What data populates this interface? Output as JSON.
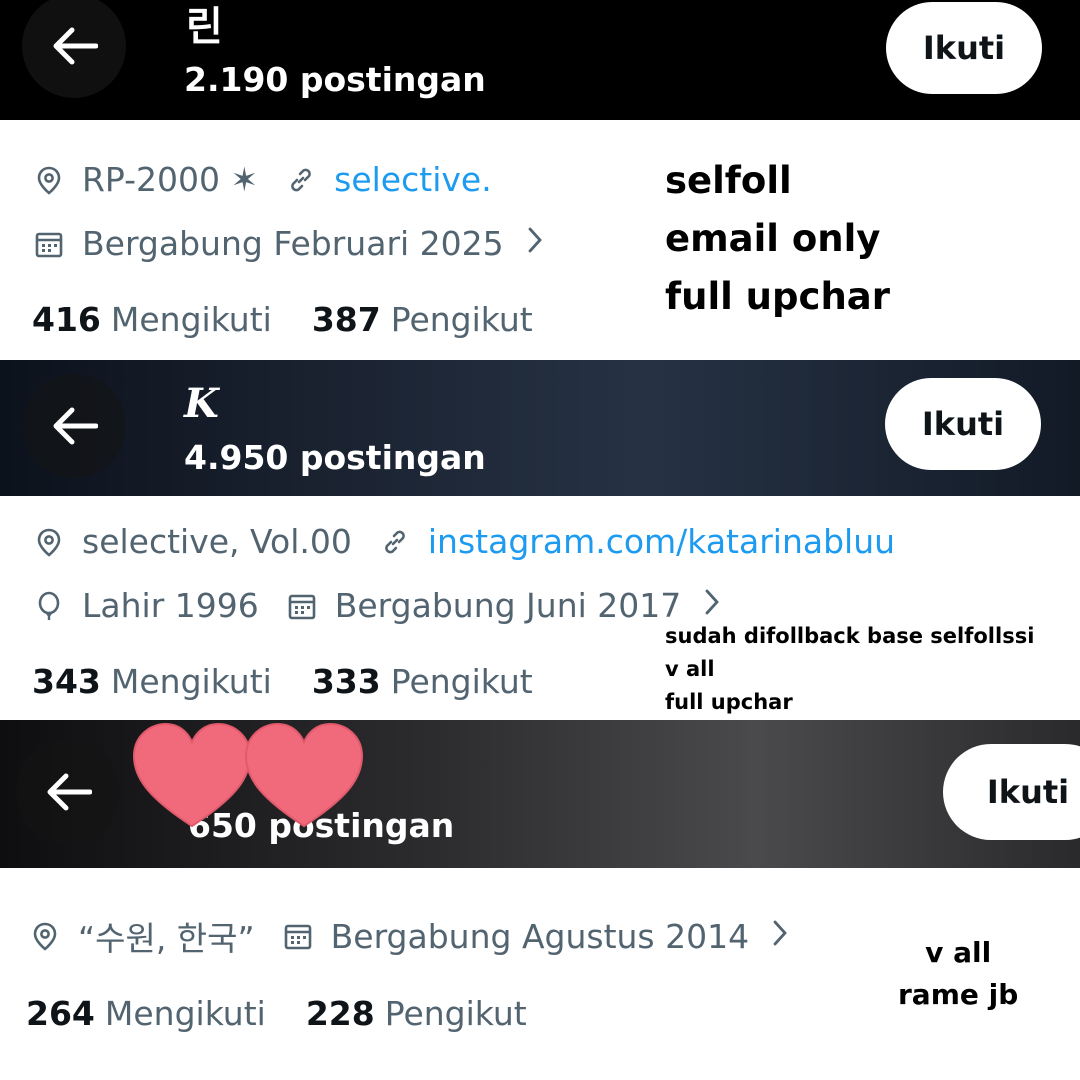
{
  "profiles": [
    {
      "handle": "린",
      "posts": "2.190 postingan",
      "follow_label": "Ikuti",
      "location": "RP-2000 ✶",
      "website": "selective.",
      "joined": "Bergabung Februari 2025",
      "following_count": "416",
      "following_label": "Mengikuti",
      "followers_count": "387",
      "followers_label": "Pengikut",
      "note_lines": [
        "selfoll",
        "email only",
        "full upchar"
      ]
    },
    {
      "handle": "K",
      "posts": "4.950 postingan",
      "follow_label": "Ikuti",
      "location": "selective, Vol.00",
      "website": "instagram.com/katarinabluu",
      "birth": "Lahir 1996",
      "joined": "Bergabung Juni 2017",
      "following_count": "343",
      "following_label": "Mengikuti",
      "followers_count": "333",
      "followers_label": "Pengikut",
      "note_lines": [
        "sudah difollback base selfollssi",
        "v all",
        "full upchar"
      ]
    },
    {
      "posts": "650 postingan",
      "follow_label": "Ikuti",
      "location": "“수원, 한국”",
      "joined": "Bergabung Agustus 2014",
      "following_count": "264",
      "following_label": "Mengikuti",
      "followers_count": "228",
      "followers_label": "Pengikut",
      "note_lines": [
        "v all",
        "rame jb"
      ]
    }
  ],
  "icons": {
    "back": "arrow-left-icon",
    "location": "location-pin-icon",
    "link": "link-icon",
    "calendar": "calendar-icon",
    "birth": "balloon-icon",
    "chevron": "chevron-right-icon",
    "sticker": "heart-sticker"
  },
  "colors": {
    "link": "#1d9bf0",
    "muted_text": "#536471",
    "strong_text": "#0f1419",
    "heart": "#f06a7c"
  }
}
